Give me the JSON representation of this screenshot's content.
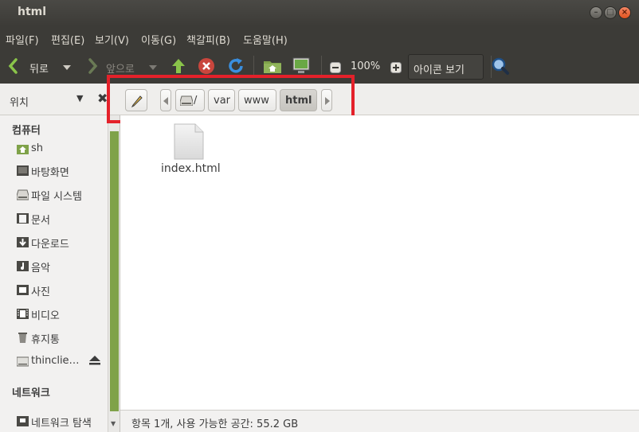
{
  "window": {
    "title": "html"
  },
  "menu": [
    "파일(F)",
    "편집(E)",
    "보기(V)",
    "이동(G)",
    "책갈피(B)",
    "도움말(H)"
  ],
  "toolbar": {
    "back_label": "뒤로",
    "forward_label": "앞으로",
    "zoom": "100%",
    "view_mode": "아이콘 보기"
  },
  "sidebar": {
    "header_label": "위치",
    "section_computer": "컴퓨터",
    "items": [
      "sh",
      "바탕화면",
      "파일 시스템",
      "문서",
      "다운로드",
      "음악",
      "사진",
      "비디오",
      "휴지통",
      "thinclie…"
    ],
    "section_network": "네트워크",
    "network_items": [
      "네트워크 탐색"
    ]
  },
  "pathbar": {
    "root": "/",
    "crumbs": [
      "var",
      "www",
      "html"
    ]
  },
  "files": [
    {
      "name": "index.html"
    }
  ],
  "status": {
    "text": "항목 1개, 사용 가능한 공간: 55.2 GB"
  },
  "colors": {
    "accent": "#7fa249",
    "highlight": "#e4212a",
    "titlebar": "#3c3b37"
  }
}
